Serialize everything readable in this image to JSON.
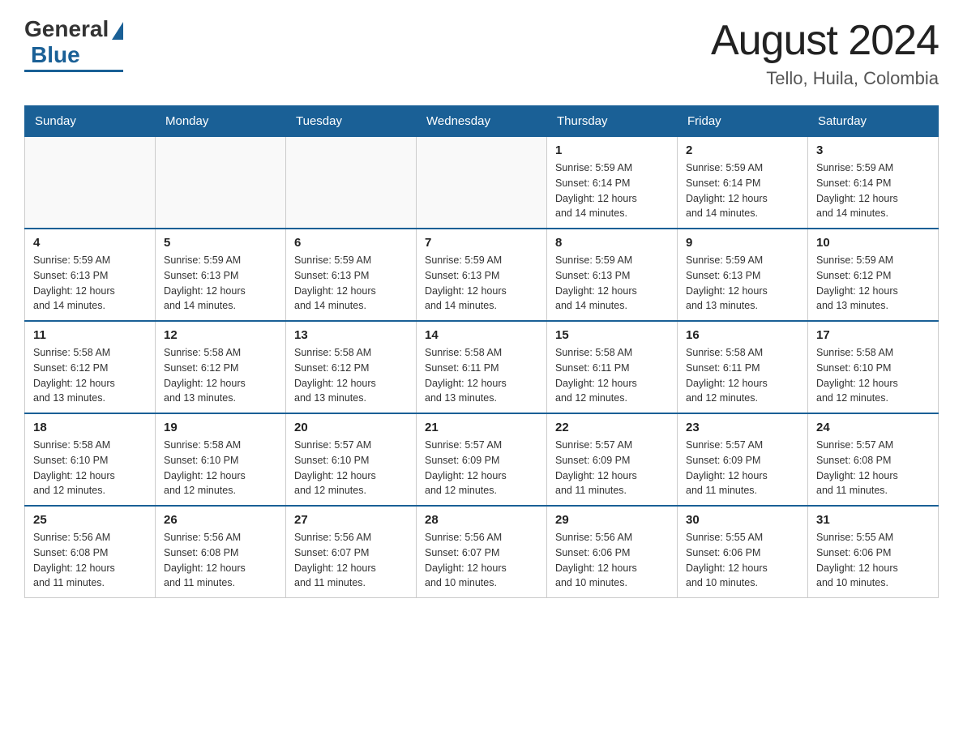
{
  "header": {
    "logo": {
      "general": "General",
      "blue": "Blue"
    },
    "title": "August 2024",
    "location": "Tello, Huila, Colombia"
  },
  "days_of_week": [
    "Sunday",
    "Monday",
    "Tuesday",
    "Wednesday",
    "Thursday",
    "Friday",
    "Saturday"
  ],
  "weeks": [
    [
      {
        "day": "",
        "info": ""
      },
      {
        "day": "",
        "info": ""
      },
      {
        "day": "",
        "info": ""
      },
      {
        "day": "",
        "info": ""
      },
      {
        "day": "1",
        "info": "Sunrise: 5:59 AM\nSunset: 6:14 PM\nDaylight: 12 hours\nand 14 minutes."
      },
      {
        "day": "2",
        "info": "Sunrise: 5:59 AM\nSunset: 6:14 PM\nDaylight: 12 hours\nand 14 minutes."
      },
      {
        "day": "3",
        "info": "Sunrise: 5:59 AM\nSunset: 6:14 PM\nDaylight: 12 hours\nand 14 minutes."
      }
    ],
    [
      {
        "day": "4",
        "info": "Sunrise: 5:59 AM\nSunset: 6:13 PM\nDaylight: 12 hours\nand 14 minutes."
      },
      {
        "day": "5",
        "info": "Sunrise: 5:59 AM\nSunset: 6:13 PM\nDaylight: 12 hours\nand 14 minutes."
      },
      {
        "day": "6",
        "info": "Sunrise: 5:59 AM\nSunset: 6:13 PM\nDaylight: 12 hours\nand 14 minutes."
      },
      {
        "day": "7",
        "info": "Sunrise: 5:59 AM\nSunset: 6:13 PM\nDaylight: 12 hours\nand 14 minutes."
      },
      {
        "day": "8",
        "info": "Sunrise: 5:59 AM\nSunset: 6:13 PM\nDaylight: 12 hours\nand 14 minutes."
      },
      {
        "day": "9",
        "info": "Sunrise: 5:59 AM\nSunset: 6:13 PM\nDaylight: 12 hours\nand 13 minutes."
      },
      {
        "day": "10",
        "info": "Sunrise: 5:59 AM\nSunset: 6:12 PM\nDaylight: 12 hours\nand 13 minutes."
      }
    ],
    [
      {
        "day": "11",
        "info": "Sunrise: 5:58 AM\nSunset: 6:12 PM\nDaylight: 12 hours\nand 13 minutes."
      },
      {
        "day": "12",
        "info": "Sunrise: 5:58 AM\nSunset: 6:12 PM\nDaylight: 12 hours\nand 13 minutes."
      },
      {
        "day": "13",
        "info": "Sunrise: 5:58 AM\nSunset: 6:12 PM\nDaylight: 12 hours\nand 13 minutes."
      },
      {
        "day": "14",
        "info": "Sunrise: 5:58 AM\nSunset: 6:11 PM\nDaylight: 12 hours\nand 13 minutes."
      },
      {
        "day": "15",
        "info": "Sunrise: 5:58 AM\nSunset: 6:11 PM\nDaylight: 12 hours\nand 12 minutes."
      },
      {
        "day": "16",
        "info": "Sunrise: 5:58 AM\nSunset: 6:11 PM\nDaylight: 12 hours\nand 12 minutes."
      },
      {
        "day": "17",
        "info": "Sunrise: 5:58 AM\nSunset: 6:10 PM\nDaylight: 12 hours\nand 12 minutes."
      }
    ],
    [
      {
        "day": "18",
        "info": "Sunrise: 5:58 AM\nSunset: 6:10 PM\nDaylight: 12 hours\nand 12 minutes."
      },
      {
        "day": "19",
        "info": "Sunrise: 5:58 AM\nSunset: 6:10 PM\nDaylight: 12 hours\nand 12 minutes."
      },
      {
        "day": "20",
        "info": "Sunrise: 5:57 AM\nSunset: 6:10 PM\nDaylight: 12 hours\nand 12 minutes."
      },
      {
        "day": "21",
        "info": "Sunrise: 5:57 AM\nSunset: 6:09 PM\nDaylight: 12 hours\nand 12 minutes."
      },
      {
        "day": "22",
        "info": "Sunrise: 5:57 AM\nSunset: 6:09 PM\nDaylight: 12 hours\nand 11 minutes."
      },
      {
        "day": "23",
        "info": "Sunrise: 5:57 AM\nSunset: 6:09 PM\nDaylight: 12 hours\nand 11 minutes."
      },
      {
        "day": "24",
        "info": "Sunrise: 5:57 AM\nSunset: 6:08 PM\nDaylight: 12 hours\nand 11 minutes."
      }
    ],
    [
      {
        "day": "25",
        "info": "Sunrise: 5:56 AM\nSunset: 6:08 PM\nDaylight: 12 hours\nand 11 minutes."
      },
      {
        "day": "26",
        "info": "Sunrise: 5:56 AM\nSunset: 6:08 PM\nDaylight: 12 hours\nand 11 minutes."
      },
      {
        "day": "27",
        "info": "Sunrise: 5:56 AM\nSunset: 6:07 PM\nDaylight: 12 hours\nand 11 minutes."
      },
      {
        "day": "28",
        "info": "Sunrise: 5:56 AM\nSunset: 6:07 PM\nDaylight: 12 hours\nand 10 minutes."
      },
      {
        "day": "29",
        "info": "Sunrise: 5:56 AM\nSunset: 6:06 PM\nDaylight: 12 hours\nand 10 minutes."
      },
      {
        "day": "30",
        "info": "Sunrise: 5:55 AM\nSunset: 6:06 PM\nDaylight: 12 hours\nand 10 minutes."
      },
      {
        "day": "31",
        "info": "Sunrise: 5:55 AM\nSunset: 6:06 PM\nDaylight: 12 hours\nand 10 minutes."
      }
    ]
  ]
}
